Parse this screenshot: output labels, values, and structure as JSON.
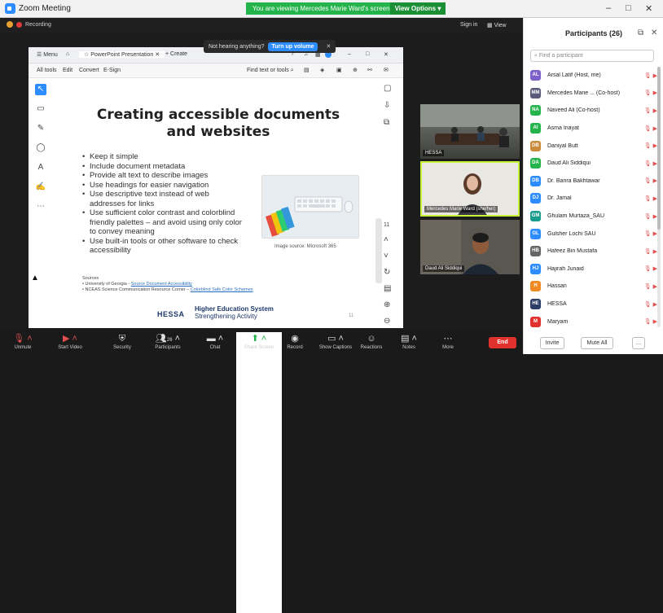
{
  "window": {
    "app_title": "Zoom Meeting",
    "minimize": "–",
    "maximize": "□",
    "close": "✕"
  },
  "banner": {
    "text": "You are viewing Mercedes Marie Ward's screen",
    "options": "View Options"
  },
  "sharebar": {
    "recording": "Recording",
    "sign_in": "Sign in",
    "view": "View"
  },
  "notice": {
    "text": "Not hearing anything?",
    "button": "Turn up volume",
    "close": "✕"
  },
  "ppt": {
    "menu": "Menu",
    "tab_title": "PowerPoint Presentation",
    "tab_create": "Create",
    "tools": [
      "All tools",
      "Edit",
      "Convert",
      "E-Sign"
    ],
    "find": "Find text or tools"
  },
  "slide": {
    "title_line1": "Creating accessible documents",
    "title_line2": "and websites",
    "bullets": [
      "Keep it simple",
      "Include document metadata",
      "Provide alt text to describe images",
      "Use headings for easier navigation",
      "Use descriptive text instead of web addresses for links",
      "Use sufficient color contrast and colorblind friendly palettes – and avoid using only color to convey meaning",
      "Use built-in tools or other software to check accessibility"
    ],
    "image_caption": "Image source: Microsoft 365",
    "sources_label": "Sources",
    "source1_prefix": "University of Georgia - ",
    "source1_link": "Source Document Accessibility",
    "source2_prefix": "NCEAS Science Communication Resource Corner – ",
    "source2_link": "Colorblind Safe Color Schemes",
    "logo": "HESSA",
    "logo_sub1": "Higher Education System",
    "logo_sub2": "Strengthening Activity",
    "page_number": "11"
  },
  "videos": [
    {
      "name": "HESSA"
    },
    {
      "name": "Mercedes Marie Ward (she/her)"
    },
    {
      "name": "Daud Ali Siddiqui"
    }
  ],
  "participants": {
    "title": "Participants (26)",
    "search_placeholder": "Find a participant",
    "list": [
      {
        "initials": "AL",
        "color": "#7b61c9",
        "name": "Arsal Latif (Host, me)"
      },
      {
        "initials": "MM",
        "color": "#5a5a7a",
        "name": "Mercedes Marie ... (Co-host)"
      },
      {
        "initials": "NA",
        "color": "#25b34b",
        "name": "Naveed Ali (Co-host)"
      },
      {
        "initials": "AI",
        "color": "#25b34b",
        "name": "Asma Inayat"
      },
      {
        "initials": "DB",
        "color": "#c98a3a",
        "name": "Daniyal Butt"
      },
      {
        "initials": "DA",
        "color": "#25b34b",
        "name": "Daud Ali Siddiqui"
      },
      {
        "initials": "DB",
        "color": "#2d8cff",
        "name": "Dr. Barira Bakhtawar"
      },
      {
        "initials": "DJ",
        "color": "#2d8cff",
        "name": "Dr. Jamal"
      },
      {
        "initials": "GM",
        "color": "#1a9c8c",
        "name": "Ghulam Murtaza_SAU"
      },
      {
        "initials": "GL",
        "color": "#2d8cff",
        "name": "Gulsher Lochi SAU"
      },
      {
        "initials": "HB",
        "color": "#666666",
        "name": "Hafeez Bin Mustafa"
      },
      {
        "initials": "HJ",
        "color": "#2d8cff",
        "name": "Hajirah Junaid"
      },
      {
        "initials": "H",
        "color": "#f08a24",
        "name": "Hassan"
      },
      {
        "initials": "HE",
        "color": "#2b3f66",
        "name": "HESSA"
      },
      {
        "initials": "M",
        "color": "#e0312f",
        "name": "Maryam"
      }
    ],
    "invite": "Invite",
    "mute_all": "Mute All",
    "more": "…"
  },
  "toolbar": {
    "items": [
      "Unmute",
      "Start Video",
      "Security",
      "Participants",
      "Chat",
      "Share Screen",
      "Record",
      "Show Captions",
      "Reactions",
      "Notes",
      "More"
    ],
    "participants_count": "26",
    "end": "End"
  },
  "colors": {
    "accent": "#2d8cff",
    "share_green": "#25b34b",
    "end_red": "#e0312f"
  }
}
